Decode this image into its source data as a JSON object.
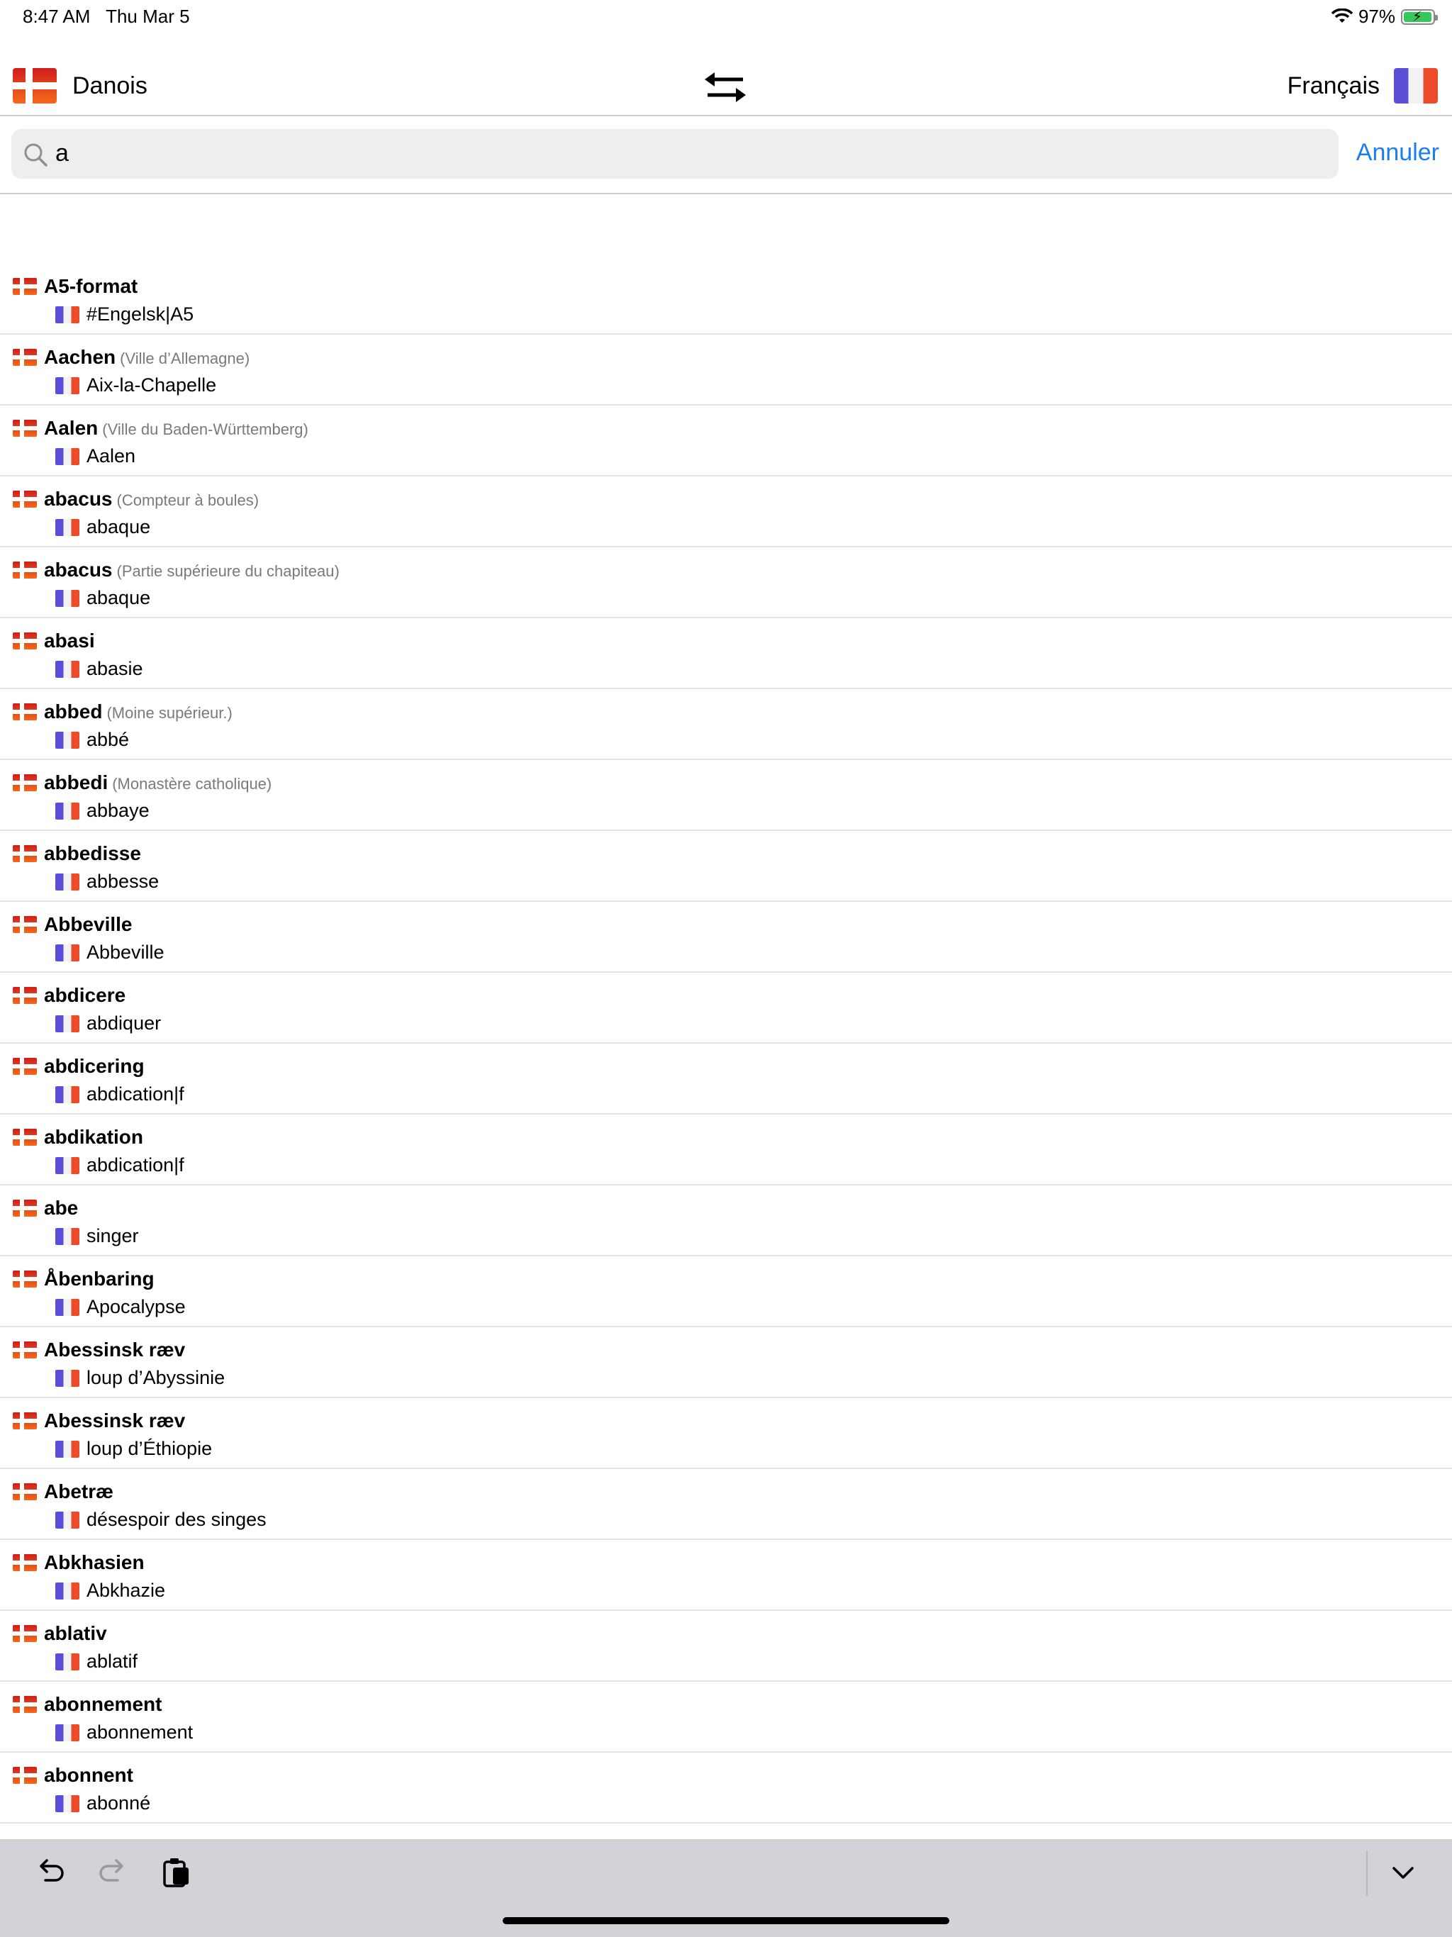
{
  "status": {
    "time": "8:47 AM",
    "date": "Thu Mar 5",
    "battery": "97%",
    "battery_level": 0.97
  },
  "langbar": {
    "source": "Danois",
    "target": "Français"
  },
  "search": {
    "value": "a",
    "cancel": "Annuler"
  },
  "entries": [
    {
      "word": "A5-format",
      "note": "",
      "translation": "#Engelsk|A5"
    },
    {
      "word": "Aachen",
      "note": "(Ville d’Allemagne)",
      "translation": "Aix-la-Chapelle"
    },
    {
      "word": "Aalen",
      "note": "(Ville du Baden-Württemberg)",
      "translation": "Aalen"
    },
    {
      "word": "abacus",
      "note": "(Compteur à boules)",
      "translation": "abaque"
    },
    {
      "word": "abacus",
      "note": "(Partie supérieure du chapiteau)",
      "translation": "abaque"
    },
    {
      "word": "abasi",
      "note": "",
      "translation": "abasie"
    },
    {
      "word": "abbed",
      "note": "(Moine supérieur.)",
      "translation": "abbé"
    },
    {
      "word": "abbedi",
      "note": "(Monastère catholique)",
      "translation": "abbaye"
    },
    {
      "word": "abbedisse",
      "note": "",
      "translation": "abbesse"
    },
    {
      "word": "Abbeville",
      "note": "",
      "translation": "Abbeville"
    },
    {
      "word": "abdicere",
      "note": "",
      "translation": "abdiquer"
    },
    {
      "word": "abdicering",
      "note": "",
      "translation": "abdication|f"
    },
    {
      "word": "abdikation",
      "note": "",
      "translation": "abdication|f"
    },
    {
      "word": "abe",
      "note": "",
      "translation": "singer"
    },
    {
      "word": "Åbenbaring",
      "note": "",
      "translation": "Apocalypse"
    },
    {
      "word": "Abessinsk ræv",
      "note": "",
      "translation": "loup d’Abyssinie"
    },
    {
      "word": "Abessinsk ræv",
      "note": "",
      "translation": "loup d’Éthiopie"
    },
    {
      "word": "Abetræ",
      "note": "",
      "translation": "désespoir des singes"
    },
    {
      "word": "Abkhasien",
      "note": "",
      "translation": "Abkhazie"
    },
    {
      "word": "ablativ",
      "note": "",
      "translation": "ablatif"
    },
    {
      "word": "abonnement",
      "note": "",
      "translation": "abonnement"
    },
    {
      "word": "abonnent",
      "note": "",
      "translation": "abonné"
    }
  ],
  "toolbar": {
    "icons": [
      "undo-icon",
      "redo-icon",
      "paste-icon",
      "chevron-down-icon"
    ]
  },
  "colors": {
    "accent": "#1a7ef0",
    "toolbar_bg": "#d2d3d8",
    "search_bg": "#eeeeef"
  }
}
